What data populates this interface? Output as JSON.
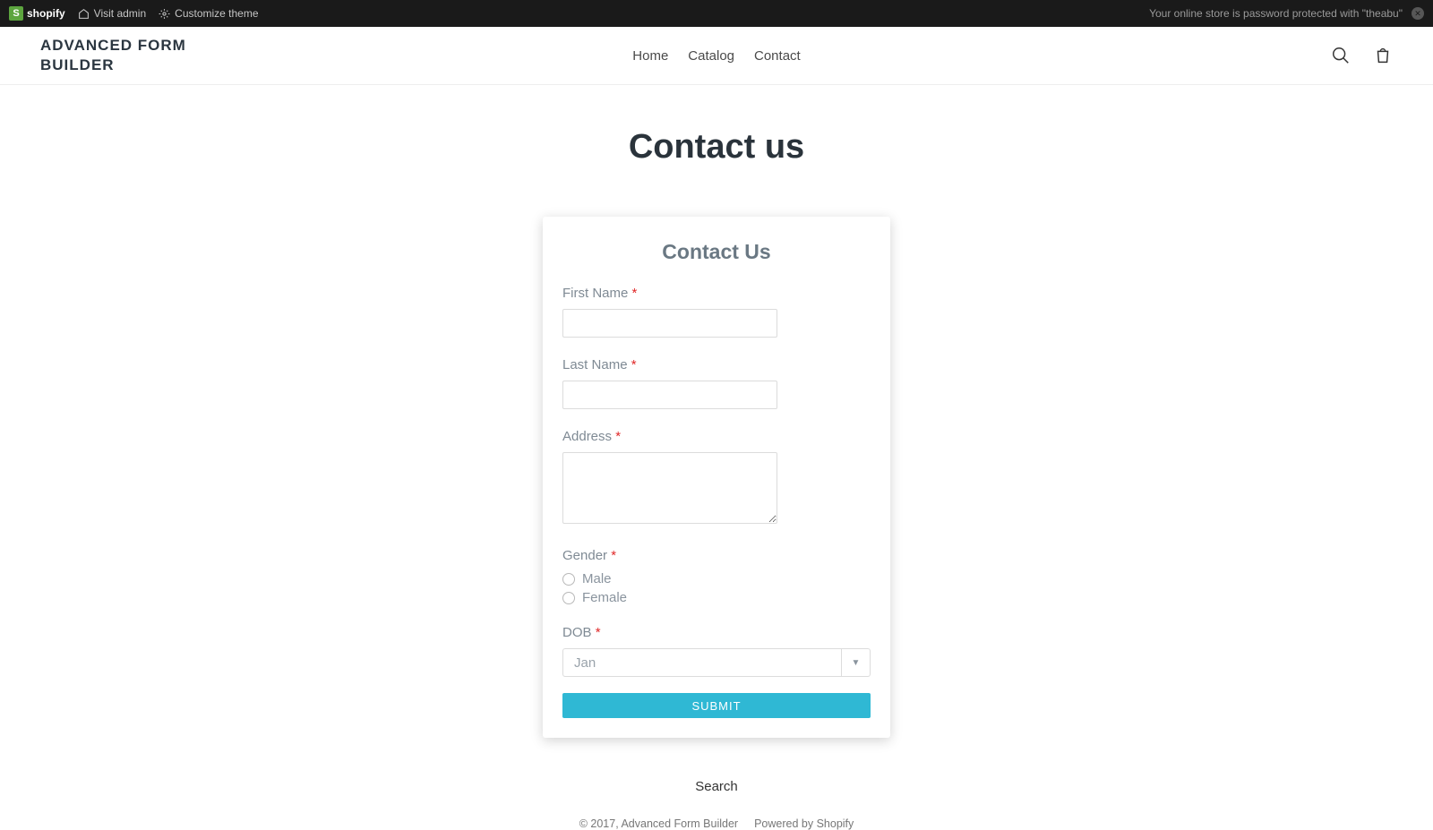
{
  "admin_bar": {
    "brand": "shopify",
    "visit_admin": "Visit admin",
    "customize_theme": "Customize theme",
    "password_notice": "Your online store is password protected with \"theabu\""
  },
  "header": {
    "site_title": "ADVANCED FORM BUILDER",
    "nav": [
      "Home",
      "Catalog",
      "Contact"
    ]
  },
  "page": {
    "title": "Contact us"
  },
  "form": {
    "card_title": "Contact Us",
    "first_name_label": "First Name",
    "last_name_label": "Last Name",
    "address_label": "Address",
    "gender_label": "Gender",
    "gender_options": [
      "Male",
      "Female"
    ],
    "dob_label": "DOB",
    "dob_value": "Jan",
    "submit_label": "SUBMIT"
  },
  "footer": {
    "search": "Search",
    "copyright_prefix": "© 2017, ",
    "store_name": "Advanced Form Builder",
    "powered": "Powered by Shopify"
  }
}
